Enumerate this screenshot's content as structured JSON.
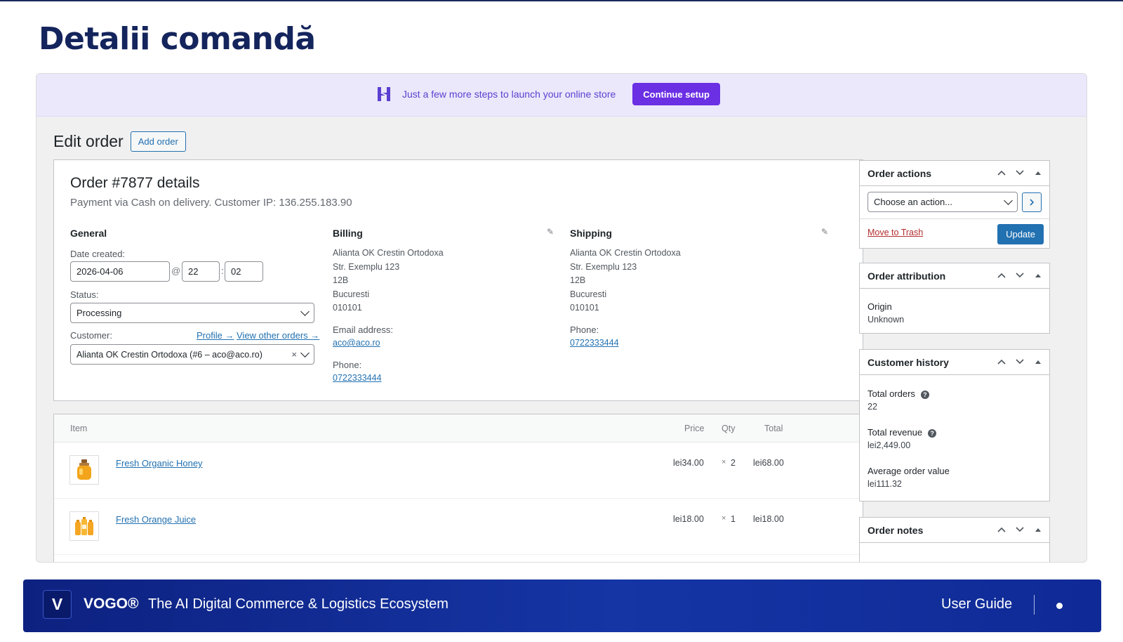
{
  "slide": {
    "title": "Detalii comandă"
  },
  "banner": {
    "text": "Just a few more steps to launch your online store",
    "button": "Continue setup"
  },
  "page": {
    "title": "Edit order",
    "add_order": "Add order"
  },
  "order": {
    "heading": "Order #7877 details",
    "subheading": "Payment via Cash on delivery. Customer IP: 136.255.183.90",
    "general": {
      "heading": "General",
      "date_label": "Date created:",
      "date": "2026-04-06",
      "at": "@",
      "hour": "22",
      "colon": ":",
      "minute": "02",
      "status_label": "Status:",
      "status": "Processing",
      "customer_label": "Customer:",
      "profile_link": "Profile →",
      "other_orders_link": "View other orders →",
      "customer": "Alianta OK Crestin Ortodoxa (#6 – aco@aco.ro)",
      "clear": "×"
    },
    "billing": {
      "heading": "Billing",
      "address": [
        "Alianta OK Crestin Ortodoxa",
        "Str. Exemplu 123",
        "12B",
        "Bucuresti",
        "010101"
      ],
      "email_label": "Email address:",
      "email": "aco@aco.ro",
      "phone_label": "Phone:",
      "phone": "0722333444"
    },
    "shipping": {
      "heading": "Shipping",
      "address": [
        "Alianta OK Crestin Ortodoxa",
        "Str. Exemplu 123",
        "12B",
        "Bucuresti",
        "010101"
      ],
      "phone_label": "Phone:",
      "phone": "0722333444"
    }
  },
  "items": {
    "headers": {
      "item": "Item",
      "price": "Price",
      "qty": "Qty",
      "total": "Total"
    },
    "rows": [
      {
        "name": "Fresh Organic Honey",
        "price": "lei34.00",
        "qty_x": "×",
        "qty": "2",
        "total": "lei68.00",
        "icon": "honey-jar-icon"
      },
      {
        "name": "Fresh Orange Juice",
        "price": "lei18.00",
        "qty_x": "×",
        "qty": "1",
        "total": "lei18.00",
        "icon": "juice-bottles-icon"
      }
    ]
  },
  "sidebar": {
    "actions": {
      "title": "Order actions",
      "select": "Choose an action...",
      "trash": "Move to Trash",
      "update": "Update"
    },
    "attribution": {
      "title": "Order attribution",
      "origin_label": "Origin",
      "origin": "Unknown"
    },
    "history": {
      "title": "Customer history",
      "total_orders_label": "Total orders",
      "total_orders": "22",
      "total_revenue_label": "Total revenue",
      "total_revenue": "lei2,449.00",
      "avg_label": "Average order value",
      "avg": "lei111.32"
    },
    "notes": {
      "title": "Order notes"
    }
  },
  "footer": {
    "logo_letter": "V",
    "brand": "VOGO®",
    "tagline": "The AI Digital Commerce & Logistics Ecosystem",
    "guide": "User Guide"
  },
  "colors": {
    "accent": "#2271b1",
    "banner_btn": "#6b2fe4",
    "footer": "#1535a5",
    "title": "#14245c"
  }
}
